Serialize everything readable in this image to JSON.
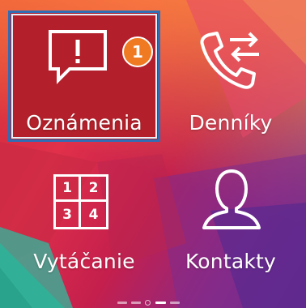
{
  "tiles": [
    {
      "label": "Oznámenia",
      "icon": "notification-alert-icon",
      "badge": "1",
      "selected": true
    },
    {
      "label": "Denníky",
      "icon": "call-log-icon"
    },
    {
      "label": "Vytáčanie",
      "icon": "dialpad-icon",
      "keys": [
        "1",
        "2",
        "3",
        "4"
      ]
    },
    {
      "label": "Kontakty",
      "icon": "contact-person-icon"
    }
  ],
  "pager": {
    "pages": 5,
    "current": 4
  },
  "colors": {
    "selection_border": "#2f6db5",
    "badge": "#f07a22",
    "selected_tile": "#b3202b"
  }
}
